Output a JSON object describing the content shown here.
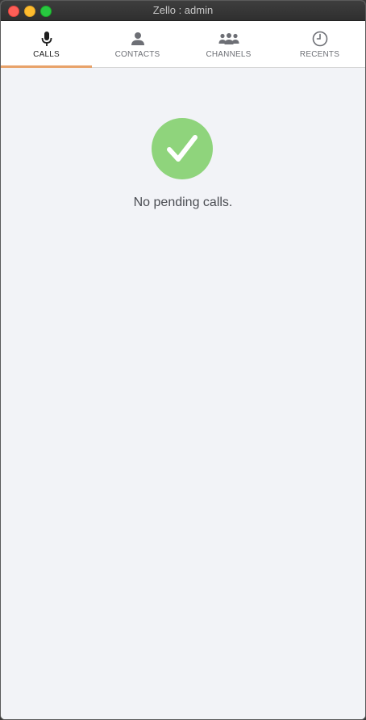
{
  "window": {
    "title": "Zello : admin"
  },
  "tabs": [
    {
      "label": "CALLS",
      "icon": "microphone-icon",
      "active": true
    },
    {
      "label": "CONTACTS",
      "icon": "person-icon",
      "active": false
    },
    {
      "label": "CHANNELS",
      "icon": "group-icon",
      "active": false
    },
    {
      "label": "RECENTS",
      "icon": "clock-icon",
      "active": false
    }
  ],
  "empty_state": {
    "icon": "checkmark-icon",
    "message": "No pending calls."
  },
  "colors": {
    "accent_underline": "#e8a26a",
    "check_circle": "#8fd47c",
    "background": "#f2f3f7"
  }
}
